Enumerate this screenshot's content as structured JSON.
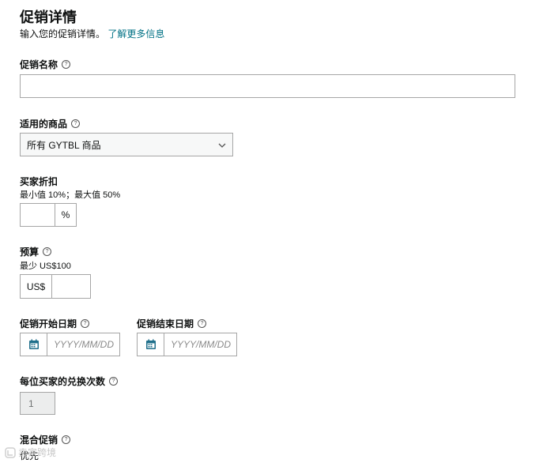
{
  "header": {
    "title": "促销详情",
    "subtitle": "输入您的促销详情。",
    "learn_more": "了解更多信息"
  },
  "fields": {
    "promo_name": {
      "label": "促销名称",
      "value": ""
    },
    "products": {
      "label": "适用的商品",
      "selected": "所有 GYTBL 商品"
    },
    "discount": {
      "label": "买家折扣",
      "hint": "最小值 10%；最大值 50%",
      "value": "",
      "unit": "%"
    },
    "budget": {
      "label": "预算",
      "hint": "最少 US$100",
      "currency": "US$",
      "value": ""
    },
    "start_date": {
      "label": "促销开始日期",
      "placeholder": "YYYY/MM/DD"
    },
    "end_date": {
      "label": "促销结束日期",
      "placeholder": "YYYY/MM/DD"
    },
    "redemptions": {
      "label": "每位买家的兑换次数",
      "value": "1"
    },
    "combine": {
      "label": "混合促销",
      "hint": "优先"
    }
  },
  "help_glyph": "?",
  "watermark": "卖家跨境",
  "colors": {
    "link": "#007185",
    "border": "#a6a6a6",
    "calendar_icon": "#1f6f8b"
  }
}
